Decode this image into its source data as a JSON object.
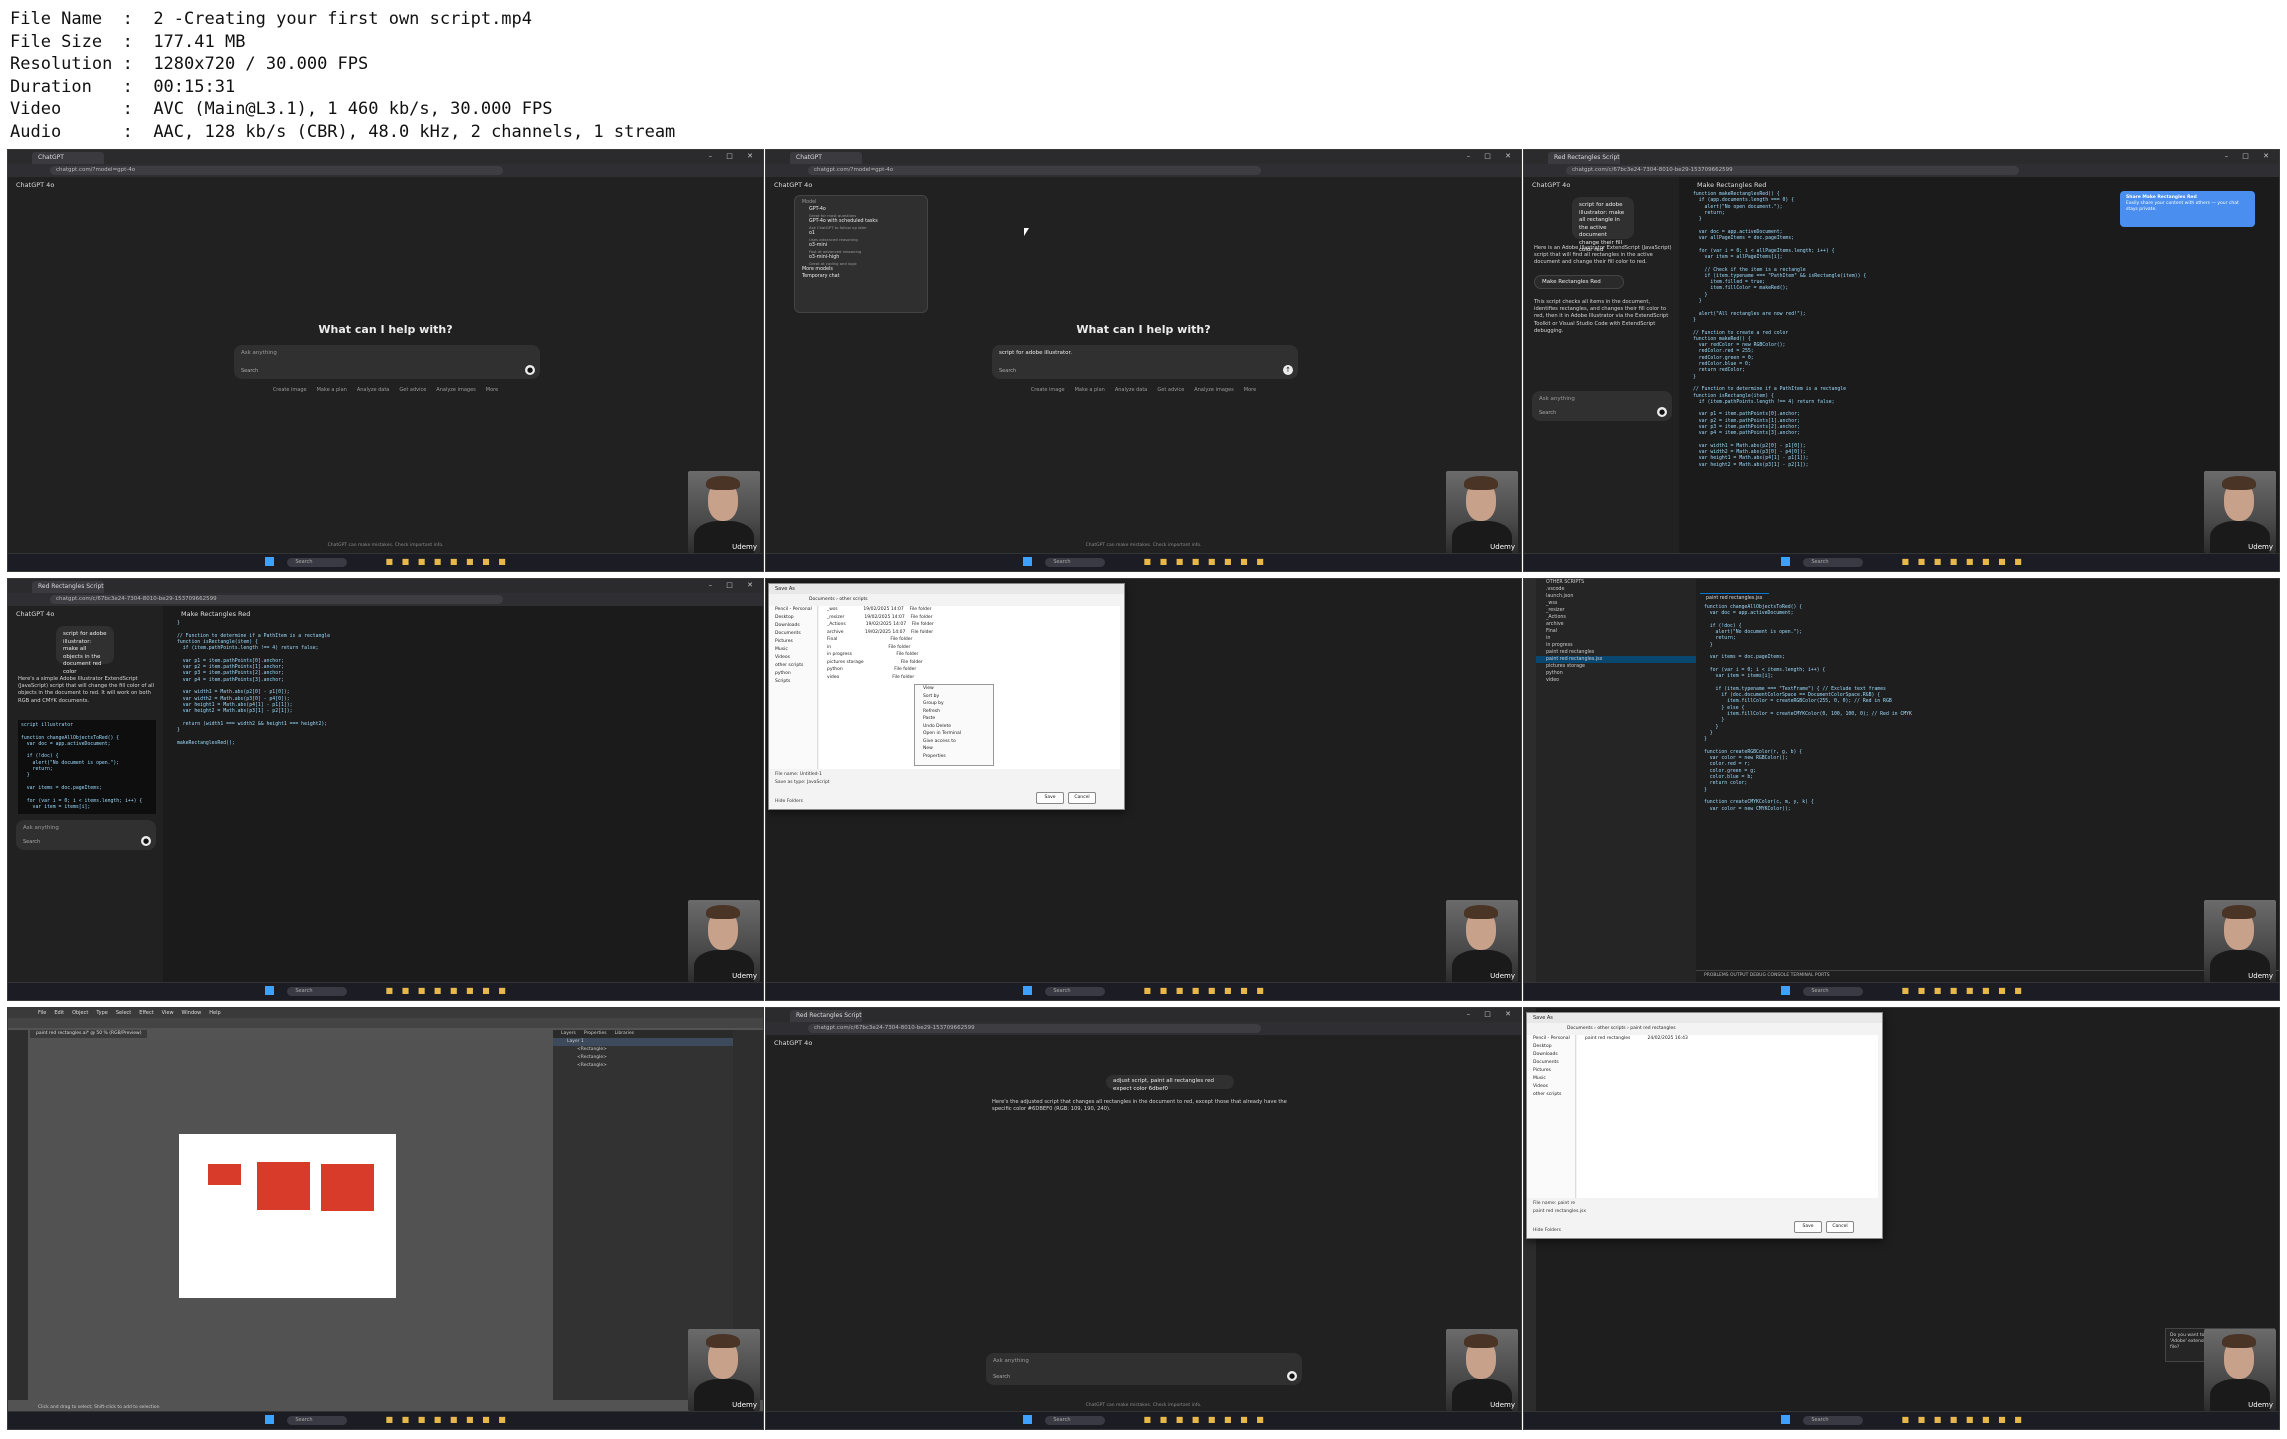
{
  "file_info": [
    {
      "key": "File Name",
      "value": "2 -Creating your first own script.mp4"
    },
    {
      "key": "File Size",
      "value": "177.41 MB"
    },
    {
      "key": "Resolution",
      "value": "1280x720 / 30.000 FPS"
    },
    {
      "key": "Duration",
      "value": "00:15:31"
    },
    {
      "key": "Video",
      "value": "AVC (Main@L3.1), 1 460 kb/s, 30.000 FPS"
    },
    {
      "key": "Audio",
      "value": "AAC, 128 kb/s (CBR), 48.0 kHz, 2 channels, 1 stream"
    }
  ],
  "common": {
    "model": "ChatGPT 4o",
    "greeting": "What can I help with?",
    "ask_placeholder": "Ask anything",
    "search_tool": "Search",
    "chips": [
      "Create image",
      "Make a plan",
      "Analyze data",
      "Get advice",
      "Analyze images",
      "More"
    ],
    "footnote": "ChatGPT can make mistakes. Check important info.",
    "taskbar_search": "Search",
    "webcam_brand": "Udemy",
    "tab_chatgpt": "ChatGPT",
    "tab_rect": "Red Rectangles Script",
    "url_home": "chatgpt.com/?model=gpt-4o",
    "url_chat": "chatgpt.com/c/67bc3e24-7304-8010-be29-153709662599"
  },
  "f2": {
    "menu_title": "Model",
    "models": [
      {
        "name": "GPT-4o",
        "desc": "Great for most questions"
      },
      {
        "name": "GPT-4o with scheduled tasks",
        "desc": "Ask ChatGPT to follow up later"
      },
      {
        "name": "o1",
        "desc": "Uses advanced reasoning"
      },
      {
        "name": "o3-mini",
        "desc": "Fast at advanced reasoning"
      },
      {
        "name": "o3-mini-high",
        "desc": "Great at coding and logic"
      }
    ],
    "more_models": "More models",
    "temporary_chat": "Temporary chat",
    "typed": "script for adobe illustrator."
  },
  "f3": {
    "user_msg": "script for adobe illustrator: make all rectangle in the active document change their fill color red",
    "answer": "Here is an Adobe Illustrator ExtendScript (JavaScript) script that will find all rectangles in the active document and change their fill color to red.",
    "canvas_button": "Make Rectangles Red",
    "canvas_title": "Make Rectangles Red",
    "answer2": "This script checks all items in the document, identifies rectangles, and changes their fill color to red, then it in Adobe Illustrator via the ExtendScript Toolkit or Visual Studio Code with ExtendScript debugging.",
    "toast_title": "Share Make Rectangles Red",
    "toast_body": "Easily share your content with others — your chat stays private.",
    "code": [
      "function makeRectanglesRed() {",
      "  if (app.documents.length === 0) {",
      "    alert(\"No open document.\");",
      "    return;",
      "  }",
      "",
      "  var doc = app.activeDocument;",
      "  var allPageItems = doc.pageItems;",
      "",
      "  for (var i = 0; i < allPageItems.length; i++) {",
      "    var item = allPageItems[i];",
      "",
      "    // Check if the item is a rectangle",
      "    if (item.typename === \"PathItem\" && isRectangle(item)) {",
      "      item.filled = true;",
      "      item.fillColor = makeRed();",
      "    }",
      "  }",
      "",
      "  alert(\"All rectangles are now red!\");",
      "}",
      "",
      "// Function to create a red color",
      "function makeRed() {",
      "  var redColor = new RGBColor();",
      "  redColor.red = 255;",
      "  redColor.green = 0;",
      "  redColor.blue = 0;",
      "  return redColor;",
      "}",
      "",
      "// Function to determine if a PathItem is a rectangle",
      "function isRectangle(item) {",
      "  if (item.pathPoints.length !== 4) return false;",
      "",
      "  var p1 = item.pathPoints[0].anchor;",
      "  var p2 = item.pathPoints[1].anchor;",
      "  var p3 = item.pathPoints[2].anchor;",
      "  var p4 = item.pathPoints[3].anchor;",
      "",
      "  var width1 = Math.abs(p2[0] - p1[0]);",
      "  var width2 = Math.abs(p3[0] - p4[0]);",
      "  var height1 = Math.abs(p4[1] - p1[1]);",
      "  var height2 = Math.abs(p3[1] - p2[1]);"
    ]
  },
  "f4": {
    "user_msg": "script for adobe illustrator: make all objects in the document red color",
    "answer": "Here's a simple Adobe Illustrator ExtendScript (JavaScript) script that will change the fill color of all objects in the document to red. It will work on both RGB and CMYK documents.",
    "canvas_title": "Make Rectangles Red",
    "snippet": [
      "script illustrator",
      "",
      "function changeAllObjectsToRed() {",
      "  var doc = app.activeDocument;",
      "",
      "  if (!doc) {",
      "    alert(\"No document is open.\");",
      "    return;",
      "  }",
      "",
      "  var items = doc.pageItems;",
      "",
      "  for (var i = 0; i < items.length; i++) {",
      "    var item = items[i];"
    ],
    "code": [
      "}",
      "",
      "// Function to determine if a PathItem is a rectangle",
      "function isRectangle(item) {",
      "  if (item.pathPoints.length !== 4) return false;",
      "",
      "  var p1 = item.pathPoints[0].anchor;",
      "  var p2 = item.pathPoints[1].anchor;",
      "  var p3 = item.pathPoints[2].anchor;",
      "  var p4 = item.pathPoints[3].anchor;",
      "",
      "  var width1 = Math.abs(p2[0] - p1[0]);",
      "  var width2 = Math.abs(p3[0] - p4[0]);",
      "  var height1 = Math.abs(p4[1] - p1[1]);",
      "  var height2 = Math.abs(p3[1] - p2[1]);",
      "",
      "  return (width1 === width2 && height1 === height2);",
      "}",
      "",
      "makeRectanglesRed();"
    ]
  },
  "f5": {
    "dialog_title": "Save As",
    "path": "Documents › other scripts",
    "nav": [
      "Pencil - Personal",
      "Desktop",
      "Downloads",
      "Documents",
      "Pictures",
      "Music",
      "Videos",
      "other scripts",
      "python",
      "Scripts"
    ],
    "files": [
      {
        "name": "_wss",
        "date": "19/02/2025 14:07",
        "type": "File folder"
      },
      {
        "name": "_resizer",
        "date": "19/02/2025 14:07",
        "type": "File folder"
      },
      {
        "name": "_Actions",
        "date": "19/02/2025 14:07",
        "type": "File folder"
      },
      {
        "name": "archive",
        "date": "19/02/2025 14:07",
        "type": "File folder"
      },
      {
        "name": "Final",
        "date": "",
        "type": "File folder"
      },
      {
        "name": "in",
        "date": "",
        "type": "File folder"
      },
      {
        "name": "in progress",
        "date": "",
        "type": "File folder"
      },
      {
        "name": "pictures storage",
        "date": "",
        "type": "File folder"
      },
      {
        "name": "python",
        "date": "",
        "type": "File folder"
      },
      {
        "name": "video",
        "date": "",
        "type": "File folder"
      }
    ],
    "context_menu": [
      "View",
      "Sort by",
      "Group by",
      "Refresh",
      "Paste",
      "Undo Delete",
      "Open in Terminal",
      "Give access to",
      "New",
      "Properties"
    ],
    "file_name_label": "File name:",
    "file_name": "Untitled-1",
    "save_type_label": "Save as type:",
    "save_type": "JavaScript",
    "hide_folders": "Hide Folders",
    "save": "Save",
    "cancel": "Cancel"
  },
  "f6": {
    "explorer_title": "OTHER SCRIPTS",
    "tree": [
      ".vscode",
      "launch.json",
      "_wss",
      "_resizer",
      "_Actions",
      "archive",
      "Final",
      "in",
      "in progress",
      "paint red rectangles",
      "paint red rectangles.jsx",
      "pictures storage",
      "python",
      "video"
    ],
    "selected": "paint red rectangles.jsx",
    "tab": "paint red rectangles.jsx",
    "terminal": "PROBLEMS   OUTPUT   DEBUG CONSOLE   TERMINAL   PORTS",
    "code": [
      "function changeAllObjectsToRed() {",
      "  var doc = app.activeDocument;",
      "",
      "  if (!doc) {",
      "    alert(\"No document is open.\");",
      "    return;",
      "  }",
      "",
      "  var items = doc.pageItems;",
      "",
      "  for (var i = 0; i < items.length; i++) {",
      "    var item = items[i];",
      "",
      "    if (item.typename === \"TextFrame\") { // Exclude text frames",
      "      if (doc.documentColorSpace == DocumentColorSpace.RGB) {",
      "        item.fillColor = createRGBColor(255, 0, 0); // Red in RGB",
      "      } else {",
      "        item.fillColor = createCMYKColor(0, 100, 100, 0); // Red in CMYK",
      "      }",
      "    }",
      "  }",
      "}",
      "",
      "function createRGBColor(r, g, b) {",
      "  var color = new RGBColor();",
      "  color.red = r;",
      "  color.green = g;",
      "  color.blue = b;",
      "  return color;",
      "}",
      "",
      "function createCMYKColor(c, m, y, k) {",
      "  var color = new CMYKColor();"
    ]
  },
  "f7": {
    "menu": [
      "File",
      "Edit",
      "Object",
      "Type",
      "Select",
      "Effect",
      "View",
      "Window",
      "Help"
    ],
    "doc_tab": "paint red rectangles.ai* @ 50 % (RGB/Preview)",
    "layers": [
      "Layer 1",
      "<Rectangle>",
      "<Rectangle>",
      "<Rectangle>"
    ],
    "panel_tabs": [
      "Layers",
      "Properties",
      "Libraries"
    ],
    "status": "Click and drag to select; Shift-click to add to selection"
  },
  "f8": {
    "user_msg": "adjust script, paint all rectangles red expect color 6dbef0",
    "answer": "Here's the adjusted script that changes all rectangles in the document to red, except those that already have the specific color #6DBEF0 (RGB: 109, 190, 240)."
  },
  "f9": {
    "dialog_title": "Save As",
    "path": "Documents › other scripts › paint red rectangles",
    "nav": [
      "Pencil - Personal",
      "Desktop",
      "Downloads",
      "Documents",
      "Pictures",
      "Music",
      "Videos",
      "other scripts"
    ],
    "file": "paint red rectangles",
    "date": "24/02/2025 16:43",
    "file_name": "paint re",
    "suggestion": "paint red rectangles.jsx",
    "notification": "Do you want to install the recommended 'Adobe' extension from Microsoft for the .jsx file?",
    "install": "Install"
  }
}
